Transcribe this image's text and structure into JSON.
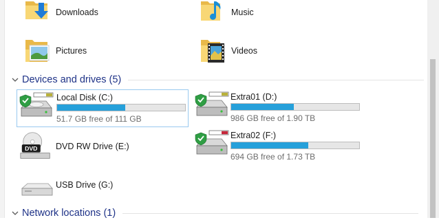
{
  "folders": [
    {
      "label": "Downloads",
      "icon": "downloads-folder-icon"
    },
    {
      "label": "Music",
      "icon": "music-folder-icon"
    },
    {
      "label": "Pictures",
      "icon": "pictures-folder-icon"
    },
    {
      "label": "Videos",
      "icon": "videos-folder-icon"
    }
  ],
  "devices_group": {
    "title": "Devices and drives (5)"
  },
  "drives": [
    {
      "name": "Local Disk (C:)",
      "free_text": "51.7 GB free of 111 GB",
      "used_fraction": 0.53,
      "selected": true,
      "icon": "system-hard-drive-icon"
    },
    {
      "name": "Extra01 (D:)",
      "free_text": "986 GB free of 1.90 TB",
      "used_fraction": 0.49,
      "icon": "hard-drive-icon"
    },
    {
      "name": "DVD RW Drive (E:)",
      "icon": "dvd-drive-icon"
    },
    {
      "name": "Extra02 (F:)",
      "free_text": "694 GB free of 1.73 TB",
      "used_fraction": 0.6,
      "icon": "hard-drive-icon"
    },
    {
      "name": "USB Drive (G:)",
      "icon": "usb-drive-icon"
    }
  ],
  "network_group": {
    "title": "Network locations (1)"
  },
  "colors": {
    "accent": "#26a0da",
    "group_title": "#1e3287",
    "selection_border": "#99c9ef"
  }
}
